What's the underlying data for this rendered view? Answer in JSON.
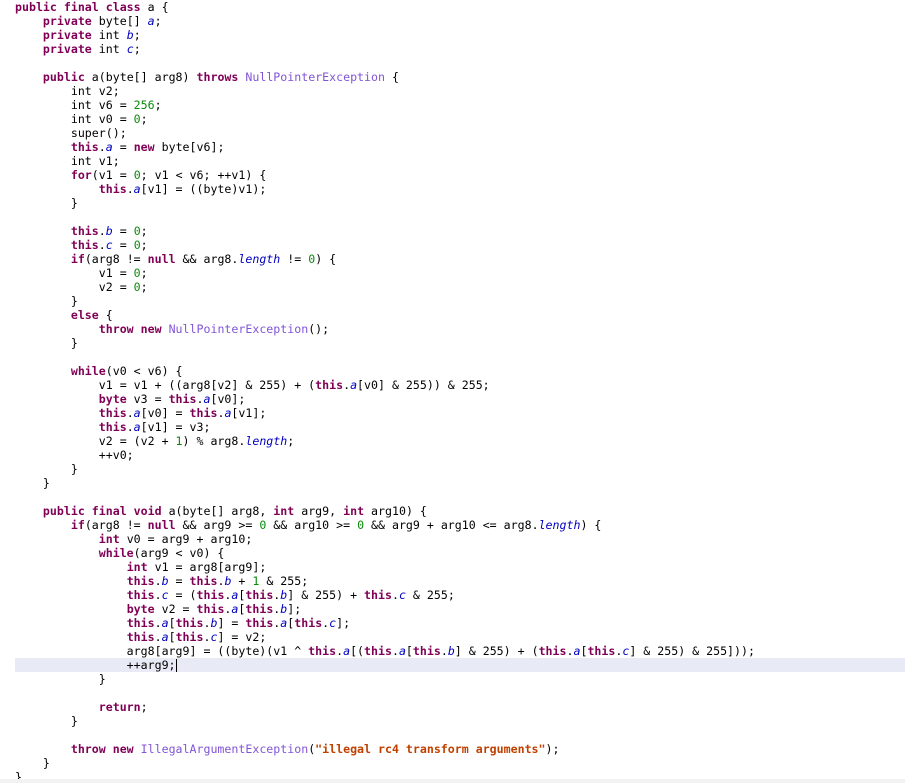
{
  "editor": {
    "language": "java",
    "current_line_index": 47,
    "lines": [
      [
        {
          "t": "kw",
          "v": "public final class"
        },
        {
          "t": "",
          "v": " a {"
        }
      ],
      [
        {
          "t": "",
          "v": "    "
        },
        {
          "t": "kw",
          "v": "private"
        },
        {
          "t": "",
          "v": " byte[] "
        },
        {
          "t": "fld",
          "v": "a"
        },
        {
          "t": "",
          "v": ";"
        }
      ],
      [
        {
          "t": "",
          "v": "    "
        },
        {
          "t": "kw",
          "v": "private"
        },
        {
          "t": "",
          "v": " int "
        },
        {
          "t": "fld",
          "v": "b"
        },
        {
          "t": "",
          "v": ";"
        }
      ],
      [
        {
          "t": "",
          "v": "    "
        },
        {
          "t": "kw",
          "v": "private"
        },
        {
          "t": "",
          "v": " int "
        },
        {
          "t": "fld",
          "v": "c"
        },
        {
          "t": "",
          "v": ";"
        }
      ],
      [
        {
          "t": "",
          "v": ""
        }
      ],
      [
        {
          "t": "",
          "v": "    "
        },
        {
          "t": "kw",
          "v": "public"
        },
        {
          "t": "",
          "v": " a(byte[] arg8) "
        },
        {
          "t": "kw",
          "v": "throws"
        },
        {
          "t": "",
          "v": " "
        },
        {
          "t": "cls",
          "v": "NullPointerException"
        },
        {
          "t": "",
          "v": " {"
        }
      ],
      [
        {
          "t": "",
          "v": "        int v2;"
        }
      ],
      [
        {
          "t": "",
          "v": "        int v6 = "
        },
        {
          "t": "num",
          "v": "256"
        },
        {
          "t": "",
          "v": ";"
        }
      ],
      [
        {
          "t": "",
          "v": "        int v0 = "
        },
        {
          "t": "num",
          "v": "0"
        },
        {
          "t": "",
          "v": ";"
        }
      ],
      [
        {
          "t": "",
          "v": "        super();"
        }
      ],
      [
        {
          "t": "",
          "v": "        "
        },
        {
          "t": "kw",
          "v": "this"
        },
        {
          "t": "",
          "v": "."
        },
        {
          "t": "fld",
          "v": "a"
        },
        {
          "t": "",
          "v": " = "
        },
        {
          "t": "kw",
          "v": "new"
        },
        {
          "t": "",
          "v": " byte[v6];"
        }
      ],
      [
        {
          "t": "",
          "v": "        int v1;"
        }
      ],
      [
        {
          "t": "",
          "v": "        "
        },
        {
          "t": "kw",
          "v": "for"
        },
        {
          "t": "",
          "v": "(v1 = "
        },
        {
          "t": "num",
          "v": "0"
        },
        {
          "t": "",
          "v": "; v1 < v6; ++v1) {"
        }
      ],
      [
        {
          "t": "",
          "v": "            "
        },
        {
          "t": "kw",
          "v": "this"
        },
        {
          "t": "",
          "v": "."
        },
        {
          "t": "fld",
          "v": "a"
        },
        {
          "t": "",
          "v": "[v1] = ((byte)v1);"
        }
      ],
      [
        {
          "t": "",
          "v": "        }"
        }
      ],
      [
        {
          "t": "",
          "v": ""
        }
      ],
      [
        {
          "t": "",
          "v": "        "
        },
        {
          "t": "kw",
          "v": "this"
        },
        {
          "t": "",
          "v": "."
        },
        {
          "t": "fld",
          "v": "b"
        },
        {
          "t": "",
          "v": " = "
        },
        {
          "t": "num",
          "v": "0"
        },
        {
          "t": "",
          "v": ";"
        }
      ],
      [
        {
          "t": "",
          "v": "        "
        },
        {
          "t": "kw",
          "v": "this"
        },
        {
          "t": "",
          "v": "."
        },
        {
          "t": "fld",
          "v": "c"
        },
        {
          "t": "",
          "v": " = "
        },
        {
          "t": "num",
          "v": "0"
        },
        {
          "t": "",
          "v": ";"
        }
      ],
      [
        {
          "t": "",
          "v": "        "
        },
        {
          "t": "kw",
          "v": "if"
        },
        {
          "t": "",
          "v": "(arg8 != "
        },
        {
          "t": "kw",
          "v": "null"
        },
        {
          "t": "",
          "v": " && arg8."
        },
        {
          "t": "fld",
          "v": "length"
        },
        {
          "t": "",
          "v": " != "
        },
        {
          "t": "num",
          "v": "0"
        },
        {
          "t": "",
          "v": ") {"
        }
      ],
      [
        {
          "t": "",
          "v": "            v1 = "
        },
        {
          "t": "num",
          "v": "0"
        },
        {
          "t": "",
          "v": ";"
        }
      ],
      [
        {
          "t": "",
          "v": "            v2 = "
        },
        {
          "t": "num",
          "v": "0"
        },
        {
          "t": "",
          "v": ";"
        }
      ],
      [
        {
          "t": "",
          "v": "        }"
        }
      ],
      [
        {
          "t": "",
          "v": "        "
        },
        {
          "t": "kw",
          "v": "else"
        },
        {
          "t": "",
          "v": " {"
        }
      ],
      [
        {
          "t": "",
          "v": "            "
        },
        {
          "t": "kw",
          "v": "throw new"
        },
        {
          "t": "",
          "v": " "
        },
        {
          "t": "cls",
          "v": "NullPointerException"
        },
        {
          "t": "",
          "v": "();"
        }
      ],
      [
        {
          "t": "",
          "v": "        }"
        }
      ],
      [
        {
          "t": "",
          "v": ""
        }
      ],
      [
        {
          "t": "",
          "v": "        "
        },
        {
          "t": "kw",
          "v": "while"
        },
        {
          "t": "",
          "v": "(v0 < v6) {"
        }
      ],
      [
        {
          "t": "",
          "v": "            v1 = v1 + ((arg8[v2] & 255) + ("
        },
        {
          "t": "kw",
          "v": "this"
        },
        {
          "t": "",
          "v": "."
        },
        {
          "t": "fld",
          "v": "a"
        },
        {
          "t": "",
          "v": "[v0] & 255)) & 255;"
        }
      ],
      [
        {
          "t": "",
          "v": "            "
        },
        {
          "t": "kw",
          "v": "byte"
        },
        {
          "t": "",
          "v": " v3 = "
        },
        {
          "t": "kw",
          "v": "this"
        },
        {
          "t": "",
          "v": "."
        },
        {
          "t": "fld",
          "v": "a"
        },
        {
          "t": "",
          "v": "[v0];"
        }
      ],
      [
        {
          "t": "",
          "v": "            "
        },
        {
          "t": "kw",
          "v": "this"
        },
        {
          "t": "",
          "v": "."
        },
        {
          "t": "fld",
          "v": "a"
        },
        {
          "t": "",
          "v": "[v0] = "
        },
        {
          "t": "kw",
          "v": "this"
        },
        {
          "t": "",
          "v": "."
        },
        {
          "t": "fld",
          "v": "a"
        },
        {
          "t": "",
          "v": "[v1];"
        }
      ],
      [
        {
          "t": "",
          "v": "            "
        },
        {
          "t": "kw",
          "v": "this"
        },
        {
          "t": "",
          "v": "."
        },
        {
          "t": "fld",
          "v": "a"
        },
        {
          "t": "",
          "v": "[v1] = v3;"
        }
      ],
      [
        {
          "t": "",
          "v": "            v2 = (v2 + "
        },
        {
          "t": "num",
          "v": "1"
        },
        {
          "t": "",
          "v": ") % arg8."
        },
        {
          "t": "fld",
          "v": "length"
        },
        {
          "t": "",
          "v": ";"
        }
      ],
      [
        {
          "t": "",
          "v": "            ++v0;"
        }
      ],
      [
        {
          "t": "",
          "v": "        }"
        }
      ],
      [
        {
          "t": "",
          "v": "    }"
        }
      ],
      [
        {
          "t": "",
          "v": ""
        }
      ],
      [
        {
          "t": "",
          "v": "    "
        },
        {
          "t": "kw",
          "v": "public final void"
        },
        {
          "t": "",
          "v": " a(byte[] arg8, "
        },
        {
          "t": "kw",
          "v": "int"
        },
        {
          "t": "",
          "v": " arg9, "
        },
        {
          "t": "kw",
          "v": "int"
        },
        {
          "t": "",
          "v": " arg10) {"
        }
      ],
      [
        {
          "t": "",
          "v": "        "
        },
        {
          "t": "kw",
          "v": "if"
        },
        {
          "t": "",
          "v": "(arg8 != "
        },
        {
          "t": "kw",
          "v": "null"
        },
        {
          "t": "",
          "v": " && arg9 >= "
        },
        {
          "t": "num",
          "v": "0"
        },
        {
          "t": "",
          "v": " && arg10 >= "
        },
        {
          "t": "num",
          "v": "0"
        },
        {
          "t": "",
          "v": " && arg9 + arg10 <= arg8."
        },
        {
          "t": "fld",
          "v": "length"
        },
        {
          "t": "",
          "v": ") {"
        }
      ],
      [
        {
          "t": "",
          "v": "            "
        },
        {
          "t": "kw",
          "v": "int"
        },
        {
          "t": "",
          "v": " v0 = arg9 + arg10;"
        }
      ],
      [
        {
          "t": "",
          "v": "            "
        },
        {
          "t": "kw",
          "v": "while"
        },
        {
          "t": "",
          "v": "(arg9 < v0) {"
        }
      ],
      [
        {
          "t": "",
          "v": "                "
        },
        {
          "t": "kw",
          "v": "int"
        },
        {
          "t": "",
          "v": " v1 = arg8[arg9];"
        }
      ],
      [
        {
          "t": "",
          "v": "                "
        },
        {
          "t": "kw",
          "v": "this"
        },
        {
          "t": "",
          "v": "."
        },
        {
          "t": "fld",
          "v": "b"
        },
        {
          "t": "",
          "v": " = "
        },
        {
          "t": "kw",
          "v": "this"
        },
        {
          "t": "",
          "v": "."
        },
        {
          "t": "fld",
          "v": "b"
        },
        {
          "t": "",
          "v": " + "
        },
        {
          "t": "num",
          "v": "1"
        },
        {
          "t": "",
          "v": " & 255;"
        }
      ],
      [
        {
          "t": "",
          "v": "                "
        },
        {
          "t": "kw",
          "v": "this"
        },
        {
          "t": "",
          "v": "."
        },
        {
          "t": "fld",
          "v": "c"
        },
        {
          "t": "",
          "v": " = ("
        },
        {
          "t": "kw",
          "v": "this"
        },
        {
          "t": "",
          "v": "."
        },
        {
          "t": "fld",
          "v": "a"
        },
        {
          "t": "",
          "v": "["
        },
        {
          "t": "kw",
          "v": "this"
        },
        {
          "t": "",
          "v": "."
        },
        {
          "t": "fld",
          "v": "b"
        },
        {
          "t": "",
          "v": "] & 255) + "
        },
        {
          "t": "kw",
          "v": "this"
        },
        {
          "t": "",
          "v": "."
        },
        {
          "t": "fld",
          "v": "c"
        },
        {
          "t": "",
          "v": " & 255;"
        }
      ],
      [
        {
          "t": "",
          "v": "                "
        },
        {
          "t": "kw",
          "v": "byte"
        },
        {
          "t": "",
          "v": " v2 = "
        },
        {
          "t": "kw",
          "v": "this"
        },
        {
          "t": "",
          "v": "."
        },
        {
          "t": "fld",
          "v": "a"
        },
        {
          "t": "",
          "v": "["
        },
        {
          "t": "kw",
          "v": "this"
        },
        {
          "t": "",
          "v": "."
        },
        {
          "t": "fld",
          "v": "b"
        },
        {
          "t": "",
          "v": "];"
        }
      ],
      [
        {
          "t": "",
          "v": "                "
        },
        {
          "t": "kw",
          "v": "this"
        },
        {
          "t": "",
          "v": "."
        },
        {
          "t": "fld",
          "v": "a"
        },
        {
          "t": "",
          "v": "["
        },
        {
          "t": "kw",
          "v": "this"
        },
        {
          "t": "",
          "v": "."
        },
        {
          "t": "fld",
          "v": "b"
        },
        {
          "t": "",
          "v": "] = "
        },
        {
          "t": "kw",
          "v": "this"
        },
        {
          "t": "",
          "v": "."
        },
        {
          "t": "fld",
          "v": "a"
        },
        {
          "t": "",
          "v": "["
        },
        {
          "t": "kw",
          "v": "this"
        },
        {
          "t": "",
          "v": "."
        },
        {
          "t": "fld",
          "v": "c"
        },
        {
          "t": "",
          "v": "];"
        }
      ],
      [
        {
          "t": "",
          "v": "                "
        },
        {
          "t": "kw",
          "v": "this"
        },
        {
          "t": "",
          "v": "."
        },
        {
          "t": "fld",
          "v": "a"
        },
        {
          "t": "",
          "v": "["
        },
        {
          "t": "kw",
          "v": "this"
        },
        {
          "t": "",
          "v": "."
        },
        {
          "t": "fld",
          "v": "c"
        },
        {
          "t": "",
          "v": "] = v2;"
        }
      ],
      [
        {
          "t": "",
          "v": "                arg8[arg9] = ((byte)(v1 ^ "
        },
        {
          "t": "kw",
          "v": "this"
        },
        {
          "t": "",
          "v": "."
        },
        {
          "t": "fld",
          "v": "a"
        },
        {
          "t": "",
          "v": "[("
        },
        {
          "t": "kw",
          "v": "this"
        },
        {
          "t": "",
          "v": "."
        },
        {
          "t": "fld",
          "v": "a"
        },
        {
          "t": "",
          "v": "["
        },
        {
          "t": "kw",
          "v": "this"
        },
        {
          "t": "",
          "v": "."
        },
        {
          "t": "fld",
          "v": "b"
        },
        {
          "t": "",
          "v": "] & 255) + ("
        },
        {
          "t": "kw",
          "v": "this"
        },
        {
          "t": "",
          "v": "."
        },
        {
          "t": "fld",
          "v": "a"
        },
        {
          "t": "",
          "v": "["
        },
        {
          "t": "kw",
          "v": "this"
        },
        {
          "t": "",
          "v": "."
        },
        {
          "t": "fld",
          "v": "c"
        },
        {
          "t": "",
          "v": "] & 255) & 255]));"
        }
      ],
      [
        {
          "t": "",
          "v": "                ++arg9;"
        }
      ],
      [
        {
          "t": "",
          "v": "            }"
        }
      ],
      [
        {
          "t": "",
          "v": ""
        }
      ],
      [
        {
          "t": "",
          "v": "            "
        },
        {
          "t": "kw",
          "v": "return"
        },
        {
          "t": "",
          "v": ";"
        }
      ],
      [
        {
          "t": "",
          "v": "        }"
        }
      ],
      [
        {
          "t": "",
          "v": ""
        }
      ],
      [
        {
          "t": "",
          "v": "        "
        },
        {
          "t": "kw",
          "v": "throw new"
        },
        {
          "t": "",
          "v": " "
        },
        {
          "t": "cls",
          "v": "IllegalArgumentException"
        },
        {
          "t": "",
          "v": "("
        },
        {
          "t": "str",
          "v": "\"illegal rc4 transform arguments\""
        },
        {
          "t": "",
          "v": ");"
        }
      ],
      [
        {
          "t": "",
          "v": "    }"
        }
      ],
      [
        {
          "t": "",
          "v": "}"
        }
      ]
    ]
  }
}
